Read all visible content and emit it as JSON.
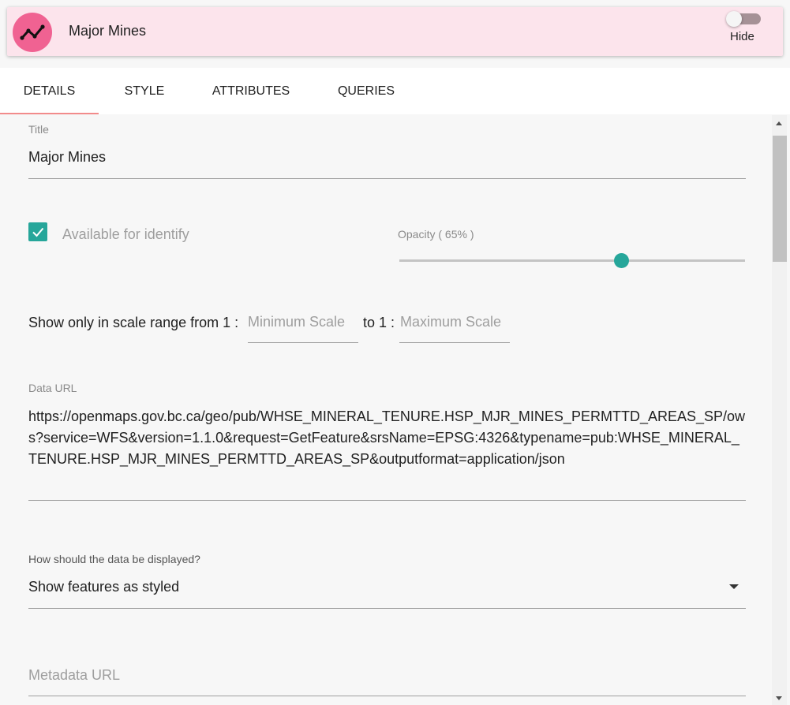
{
  "header": {
    "title": "Major Mines",
    "icon": "line-chart-icon",
    "toggle_label": "Hide",
    "toggle_on": false,
    "avatar_color": "#f06292",
    "background_color": "#fce4ec"
  },
  "tabs": [
    {
      "label": "DETAILS",
      "active": true
    },
    {
      "label": "STYLE",
      "active": false
    },
    {
      "label": "ATTRIBUTES",
      "active": false
    },
    {
      "label": "QUERIES",
      "active": false
    }
  ],
  "form": {
    "title_label": "Title",
    "title_value": "Major Mines",
    "identify_label": "Available for identify",
    "identify_checked": true,
    "opacity_label": "Opacity ( 65% )",
    "opacity_value": 0.65,
    "scale_prefix": "Show only in scale range from 1 :",
    "min_scale_placeholder": "Minimum Scale",
    "scale_middle": "to 1 :",
    "max_scale_placeholder": "Maximum Scale",
    "data_url_label": "Data URL",
    "data_url_value": "https://openmaps.gov.bc.ca/geo/pub/WHSE_MINERAL_TENURE.HSP_MJR_MINES_PERMTTD_AREAS_SP/ows?service=WFS&version=1.1.0&request=GetFeature&srsName=EPSG:4326&typename=pub:WHSE_MINERAL_TENURE.HSP_MJR_MINES_PERMTTD_AREAS_SP&outputformat=application/json",
    "display_label": "How should the data be displayed?",
    "display_value": "Show features as styled",
    "metadata_placeholder": "Metadata URL"
  },
  "colors": {
    "accent": "#26a69a",
    "tab_indicator": "#f28b8b"
  }
}
